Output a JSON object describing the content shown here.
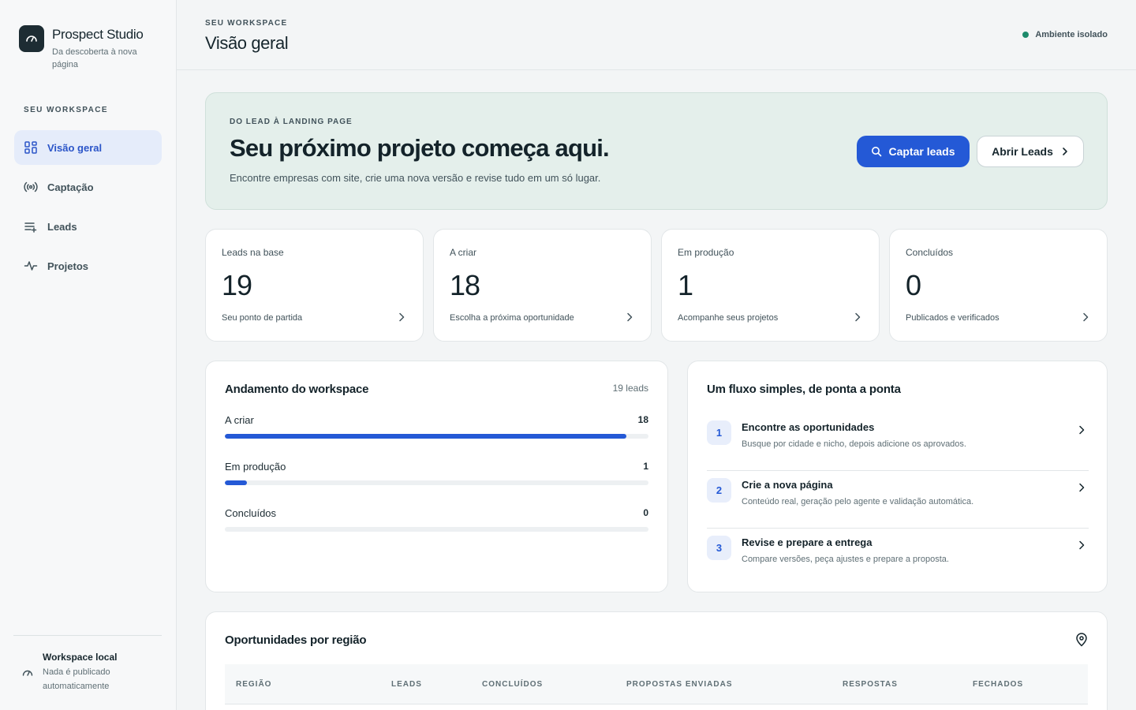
{
  "brand": {
    "name": "Prospect Studio",
    "tagline": "Da descoberta à nova página"
  },
  "sidebar": {
    "section_label": "SEU WORKSPACE",
    "items": [
      {
        "label": "Visão geral",
        "icon": "grid-icon",
        "active": true
      },
      {
        "label": "Captação",
        "icon": "broadcast-icon",
        "active": false
      },
      {
        "label": "Leads",
        "icon": "list-add-icon",
        "active": false
      },
      {
        "label": "Projetos",
        "icon": "activity-icon",
        "active": false
      }
    ],
    "workspace": {
      "title": "Workspace local",
      "subtitle": "Nada é publicado automaticamente",
      "icon": "gauge-icon"
    }
  },
  "header": {
    "eyebrow": "SEU WORKSPACE",
    "title": "Visão geral",
    "environment": "Ambiente isolado",
    "environment_color": "#1d8a6b"
  },
  "hero": {
    "eyebrow": "DO LEAD À LANDING PAGE",
    "title": "Seu próximo projeto começa aqui.",
    "subtitle": "Encontre empresas com site, crie uma nova versão e revise tudo em um só lugar.",
    "primary_button": "Captar leads",
    "secondary_button": "Abrir Leads"
  },
  "stats": [
    {
      "label": "Leads na base",
      "value": "19",
      "sub": "Seu ponto de partida"
    },
    {
      "label": "A criar",
      "value": "18",
      "sub": "Escolha a próxima oportunidade"
    },
    {
      "label": "Em produção",
      "value": "1",
      "sub": "Acompanhe seus projetos"
    },
    {
      "label": "Concluídos",
      "value": "0",
      "sub": "Publicados e verificados"
    }
  ],
  "progress": {
    "title": "Andamento do workspace",
    "meta": "19 leads",
    "total": 19,
    "rows": [
      {
        "label": "A criar",
        "value": 18
      },
      {
        "label": "Em produção",
        "value": 1
      },
      {
        "label": "Concluídos",
        "value": 0
      }
    ]
  },
  "flow": {
    "title": "Um fluxo simples, de ponta a ponta",
    "steps": [
      {
        "num": "1",
        "title": "Encontre as oportunidades",
        "desc": "Busque por cidade e nicho, depois adicione os aprovados."
      },
      {
        "num": "2",
        "title": "Crie a nova página",
        "desc": "Conteúdo real, geração pelo agente e validação automática."
      },
      {
        "num": "3",
        "title": "Revise e prepare a entrega",
        "desc": "Compare versões, peça ajustes e prepare a proposta."
      }
    ]
  },
  "regions": {
    "title": "Oportunidades por região",
    "columns": [
      "REGIÃO",
      "LEADS",
      "CONCLUÍDOS",
      "PROPOSTAS ENVIADAS",
      "RESPOSTAS",
      "FECHADOS"
    ]
  },
  "colors": {
    "accent": "#2459d6",
    "hero_bg": "#e4efeb",
    "active_nav_bg": "#e5ecfa"
  }
}
